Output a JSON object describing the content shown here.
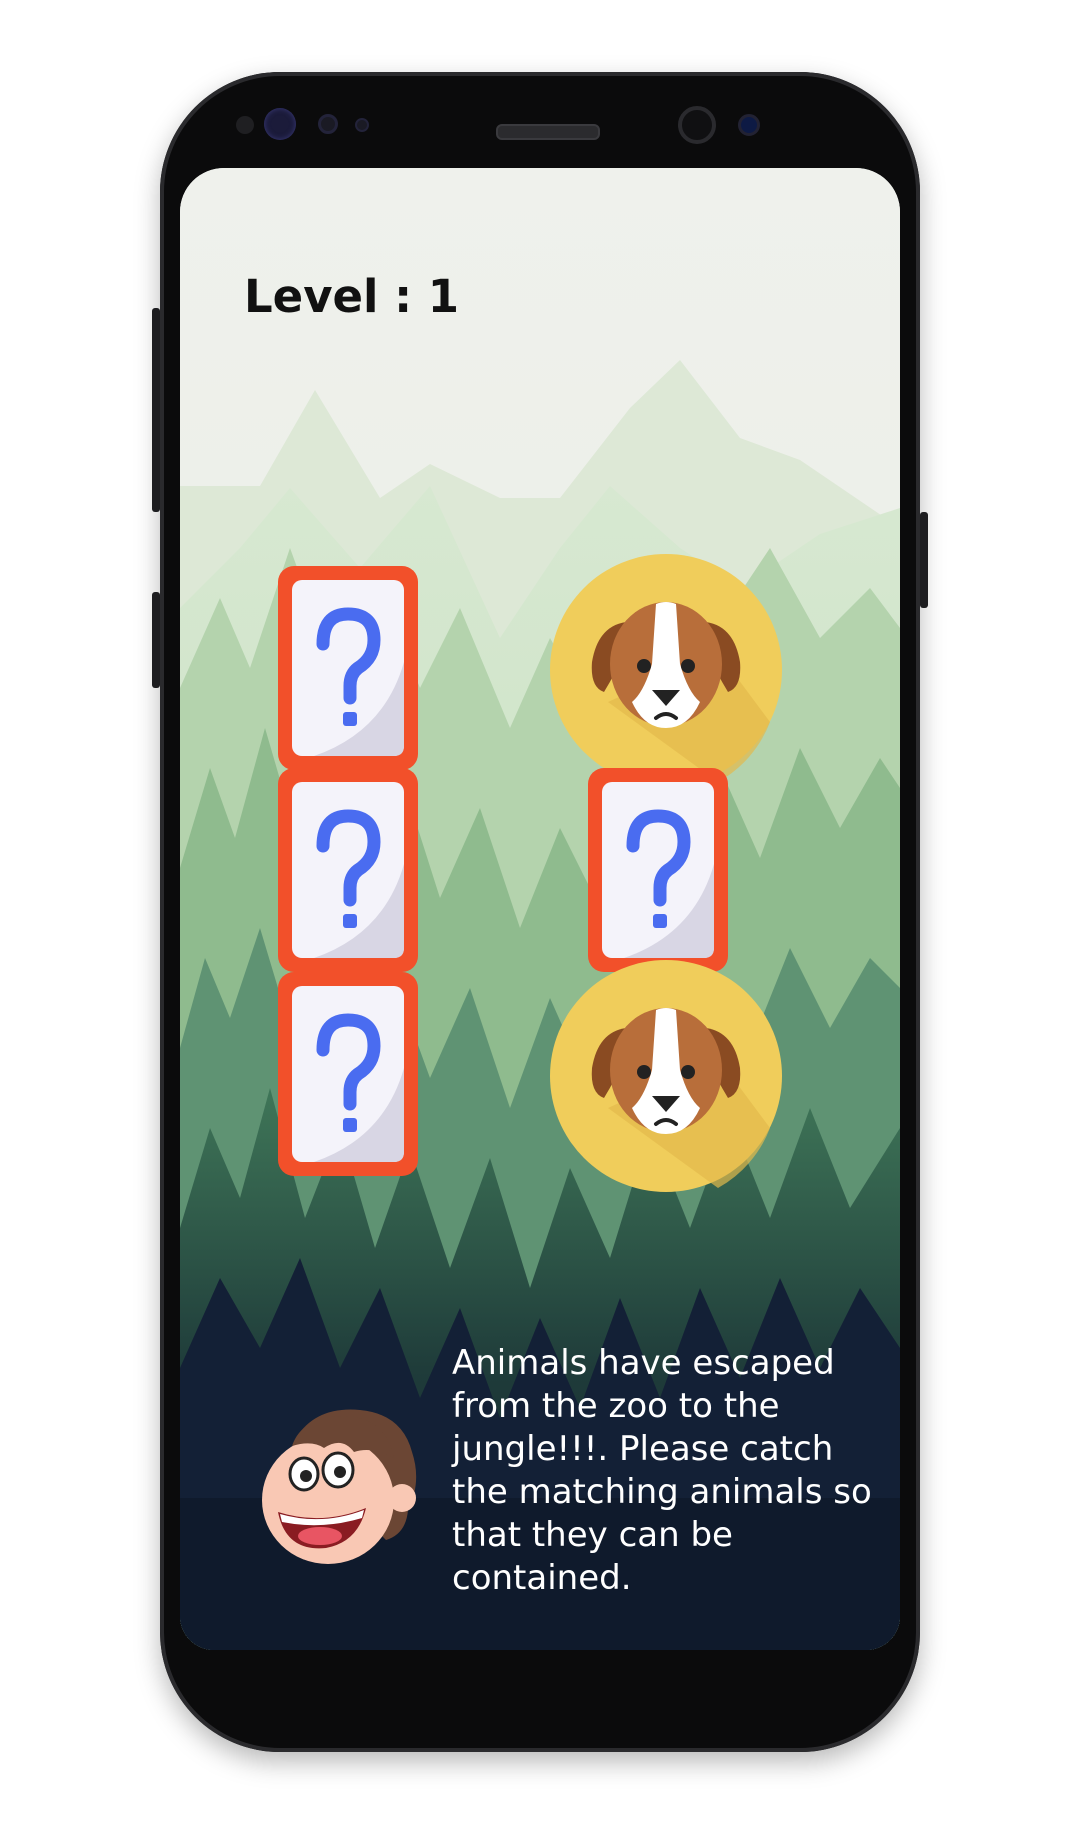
{
  "game": {
    "level_text": "Level : 1",
    "instructions": "Animals have escaped from the zoo to the jungle!!!.  Please catch the matching animals so that they can be contained."
  },
  "cards": [
    {
      "state": "hidden",
      "face": "question-mark"
    },
    {
      "state": "revealed",
      "face": "dog"
    },
    {
      "state": "hidden",
      "face": "question-mark"
    },
    {
      "state": "hidden",
      "face": "question-mark"
    },
    {
      "state": "hidden",
      "face": "question-mark"
    },
    {
      "state": "revealed",
      "face": "dog"
    }
  ],
  "colors": {
    "card_border": "#f2502a",
    "card_face": "#f4f3fa",
    "question_mark": "#4a6cf0",
    "coin": "#f0cd5b",
    "dog_brown": "#b86e3a",
    "text_light": "#ffffff",
    "level_text": "#111111"
  },
  "icons": {
    "hidden_card": "question-mark-icon",
    "revealed_card": "dog-face-icon",
    "mascot": "boy-face-icon"
  }
}
